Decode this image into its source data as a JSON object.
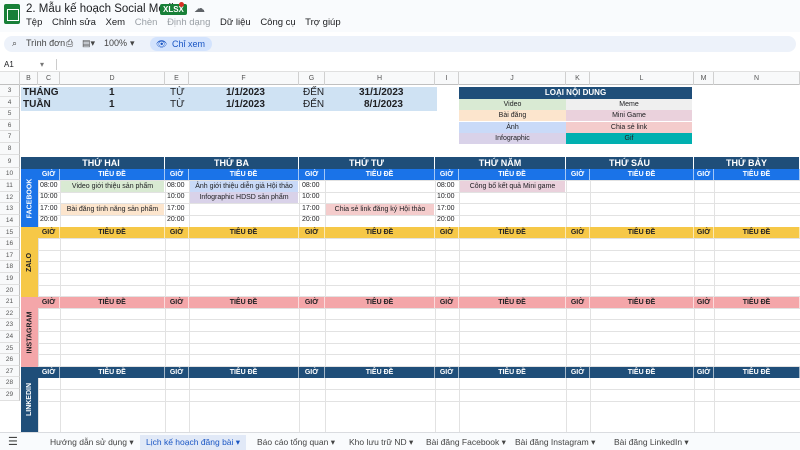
{
  "app": {
    "doc_title": "2. Mẫu kế hoạch Social Media",
    "file_badge": "XLSX",
    "menus": [
      "Tệp",
      "Chỉnh sửa",
      "Xem",
      "Chèn",
      "Định dạng",
      "Dữ liệu",
      "Công cụ",
      "Trợ giúp"
    ],
    "toolbar": {
      "search": "Trình đơn",
      "zoom": "100%",
      "view_mode": "Chỉ xem"
    },
    "cell_ref": "A1"
  },
  "columns": [
    "B",
    "C",
    "D",
    "E",
    "F",
    "G",
    "H",
    "I",
    "J",
    "K",
    "L",
    "M",
    "N"
  ],
  "rows": [
    "3",
    "4",
    "5",
    "6",
    "7",
    "8",
    "9",
    "10",
    "11",
    "12",
    "13",
    "14",
    "15",
    "16",
    "17",
    "18",
    "19",
    "20",
    "21",
    "22",
    "23",
    "24",
    "25",
    "26",
    "27",
    "28",
    "29"
  ],
  "header": {
    "thang_label": "THÁNG",
    "thang_val": "1",
    "thang_tu": "TỪ",
    "thang_from": "1/1/2023",
    "thang_den": "ĐẾN",
    "thang_to": "31/1/2023",
    "tuan_label": "TUẦN",
    "tuan_val": "1",
    "tuan_tu": "TỪ",
    "tuan_from": "1/1/2023",
    "tuan_den": "ĐẾN",
    "tuan_to": "8/1/2023"
  },
  "legend": {
    "title": "LOẠI NỘI DUNG",
    "items": [
      "Video",
      "Meme",
      "Bài đăng",
      "Mini Game",
      "Ảnh",
      "Chia sẻ link",
      "Infographic",
      "Gif"
    ]
  },
  "days": [
    "THỨ HAI",
    "THỨ BA",
    "THỨ TƯ",
    "THỨ NĂM",
    "THỨ SÁU",
    "THỨ BẢY"
  ],
  "sub": {
    "gio": "GIỜ",
    "tieude": "TIÊU ĐỀ"
  },
  "channels": [
    "FACEBOOK",
    "ZALO",
    "INSTAGRAM",
    "LINKEDIN"
  ],
  "facebook": {
    "mon": {
      "t1": "08:00",
      "v1": "Video giới thiệu sản phẩm",
      "t2": "10:00",
      "t3": "17:00",
      "v3": "Bài đăng tính năng sản phẩm",
      "t4": "20:00"
    },
    "tue": {
      "t1": "08:00",
      "v1": "Ảnh giới thiệu diễn giả Hội thảo",
      "t2": "10:00",
      "v2": "Infographic HDSD sản phẩm",
      "t3": "17:00",
      "t4": "20:00"
    },
    "wed": {
      "t1": "08:00",
      "t2": "10:00",
      "t3": "17:00",
      "v3": "Chia sẻ link đăng ký Hội thảo",
      "t4": "20:00"
    },
    "thu": {
      "t1": "08:00",
      "v1": "Công bố kết quả Mini game",
      "t2": "10:00",
      "t3": "17:00",
      "t4": "20:00"
    }
  },
  "sheets": [
    "Hướng dẫn sử dụng",
    "Lịch kế hoạch đăng bài",
    "Báo cáo tổng quan",
    "Kho lưu trữ ND",
    "Bài đăng Facebook",
    "Bài đăng Instagram",
    "Bài đăng LinkedIn"
  ],
  "colors": {
    "navy": "#1f4e79",
    "blue": "#1a73e8",
    "yellow": "#f6c847",
    "pink": "#f4a6a9",
    "lightblue": "#cfe2f3",
    "video": "#d9ead3",
    "post": "#fce5cd",
    "image": "#c9daf8",
    "info": "#d9d2e9",
    "meme": "#efefef",
    "minigame": "#ead1dc",
    "link": "#f4cccc",
    "gif": "#00b0b0"
  }
}
